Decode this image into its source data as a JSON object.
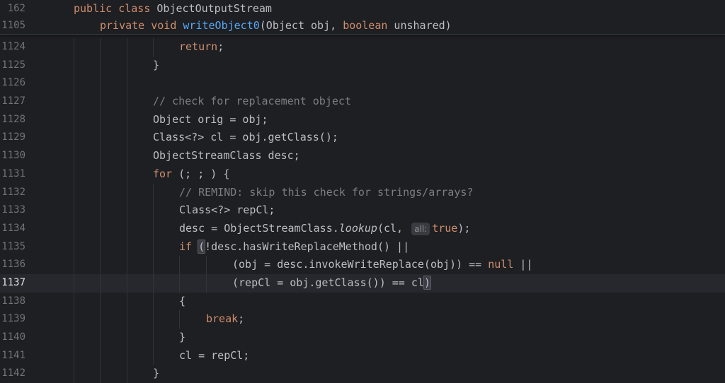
{
  "sticky": [
    {
      "num": "162",
      "indent": 104,
      "parts": [
        {
          "t": "public class",
          "c": "kw"
        },
        {
          "t": " ObjectOutputStream",
          "c": ""
        }
      ]
    },
    {
      "num": "1105",
      "indent": 141,
      "parts": [
        {
          "t": "private void",
          "c": "kw"
        },
        {
          "t": " ",
          "c": ""
        },
        {
          "t": "writeObject0",
          "c": "fn"
        },
        {
          "t": "(Object obj, ",
          "c": ""
        },
        {
          "t": "boolean",
          "c": "kw"
        },
        {
          "t": " unshared)",
          "c": ""
        }
      ]
    }
  ],
  "lines": [
    {
      "num": "1124",
      "indent": 253,
      "parts": [
        {
          "t": "return",
          "c": "kw"
        },
        {
          "t": ";",
          "c": ""
        }
      ]
    },
    {
      "num": "1125",
      "indent": 216,
      "parts": [
        {
          "t": "}",
          "c": ""
        }
      ]
    },
    {
      "num": "1126",
      "indent": 216,
      "parts": []
    },
    {
      "num": "1127",
      "indent": 216,
      "parts": [
        {
          "t": "// check for replacement object",
          "c": "cm"
        }
      ]
    },
    {
      "num": "1128",
      "indent": 216,
      "parts": [
        {
          "t": "Object orig = obj;",
          "c": ""
        }
      ]
    },
    {
      "num": "1129",
      "indent": 216,
      "parts": [
        {
          "t": "Class<?> cl = obj.getClass();",
          "c": ""
        }
      ]
    },
    {
      "num": "1130",
      "indent": 216,
      "parts": [
        {
          "t": "ObjectStreamClass desc;",
          "c": ""
        }
      ]
    },
    {
      "num": "1131",
      "indent": 216,
      "parts": [
        {
          "t": "for",
          "c": "kw"
        },
        {
          "t": " (; ; ) {",
          "c": ""
        }
      ]
    },
    {
      "num": "1132",
      "indent": 253,
      "parts": [
        {
          "t": "// REMIND: skip this check for strings/arrays?",
          "c": "cm"
        }
      ]
    },
    {
      "num": "1133",
      "indent": 253,
      "parts": [
        {
          "t": "Class<?> repCl;",
          "c": ""
        }
      ]
    },
    {
      "num": "1134",
      "indent": 253,
      "parts": [
        {
          "t": "desc = ObjectStreamClass.",
          "c": ""
        },
        {
          "t": "lookup",
          "c": "it"
        },
        {
          "t": "(cl, ",
          "c": ""
        },
        {
          "t": "all:",
          "c": "hint"
        },
        {
          "t": "true",
          "c": "kw"
        },
        {
          "t": ");",
          "c": ""
        }
      ]
    },
    {
      "num": "1135",
      "indent": 253,
      "parts": [
        {
          "t": "if",
          "c": "kw"
        },
        {
          "t": " ",
          "c": ""
        },
        {
          "t": "(",
          "c": "paren-hl"
        },
        {
          "t": "!desc.hasWriteReplaceMethod() ||",
          "c": ""
        }
      ]
    },
    {
      "num": "1136",
      "indent": 328,
      "parts": [
        {
          "t": "(obj = desc.invokeWriteReplace(obj)) == ",
          "c": ""
        },
        {
          "t": "null",
          "c": "kw"
        },
        {
          "t": " ||",
          "c": ""
        }
      ]
    },
    {
      "num": "1137",
      "indent": 328,
      "current": true,
      "parts": [
        {
          "t": "(repCl = obj.getClass()) == cl",
          "c": ""
        },
        {
          "t": ")",
          "c": "paren-hl"
        }
      ]
    },
    {
      "num": "1138",
      "indent": 253,
      "parts": [
        {
          "t": "{",
          "c": ""
        }
      ]
    },
    {
      "num": "1139",
      "indent": 291,
      "parts": [
        {
          "t": "break",
          "c": "kw"
        },
        {
          "t": ";",
          "c": ""
        }
      ]
    },
    {
      "num": "1140",
      "indent": 253,
      "parts": [
        {
          "t": "}",
          "c": ""
        }
      ]
    },
    {
      "num": "1141",
      "indent": 253,
      "parts": [
        {
          "t": "cl = repCl;",
          "c": ""
        }
      ]
    },
    {
      "num": "1142",
      "indent": 216,
      "parts": [
        {
          "t": "}",
          "c": ""
        }
      ]
    }
  ],
  "colors": {
    "background": "#1e1f22",
    "keyword": "#cf8e6d",
    "method": "#56a8f5",
    "comment": "#7a7e85",
    "text": "#bcbec4"
  }
}
